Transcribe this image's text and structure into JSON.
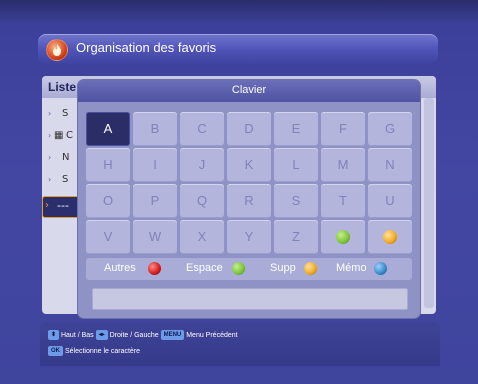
{
  "header": {
    "title": "Organisation des favoris",
    "icon": "flame-icon"
  },
  "list": {
    "header_label": "Liste",
    "rows": [
      {
        "chevron": "›",
        "glyph": "S"
      },
      {
        "chevron": "›",
        "glyph": "C"
      },
      {
        "chevron": "›",
        "glyph": "N"
      },
      {
        "chevron": "›",
        "glyph": "S"
      }
    ],
    "selected_row": {
      "chevron": "›",
      "text": "---"
    }
  },
  "keyboard": {
    "title": "Clavier",
    "rows": [
      [
        "A",
        "B",
        "C",
        "D",
        "E",
        "F",
        "G"
      ],
      [
        "H",
        "I",
        "J",
        "K",
        "L",
        "M",
        "N"
      ],
      [
        "O",
        "P",
        "Q",
        "R",
        "S",
        "T",
        "U"
      ],
      [
        "V",
        "W",
        "X",
        "Y",
        "Z",
        "",
        ""
      ]
    ],
    "active_key": "A",
    "special_keys": [
      {
        "color": "#7cc23a",
        "name": "green-button"
      },
      {
        "color": "#f0a820",
        "name": "yellow-button"
      }
    ],
    "legend": [
      {
        "label": "Autres",
        "color": "#d21a1a"
      },
      {
        "label": "Espace",
        "color": "#7cc23a"
      },
      {
        "label": "Supp",
        "color": "#f0a820"
      },
      {
        "label": "Mémo",
        "color": "#3a88c8"
      }
    ],
    "input_value": ""
  },
  "help": {
    "line1_key1": "⬍",
    "line1_text1": "Haut / Bas",
    "line1_key2": "◂▸",
    "line1_text2": "Droite / Gauche",
    "line1_key3": "MENU",
    "line1_text3": "Menu Précédent",
    "line2_key1": "OK",
    "line2_text1": "Sélectionne le caractère"
  },
  "colors": {
    "background": "#3a3f95",
    "accent": "#e8a020",
    "active_key": "#2a2d66"
  }
}
